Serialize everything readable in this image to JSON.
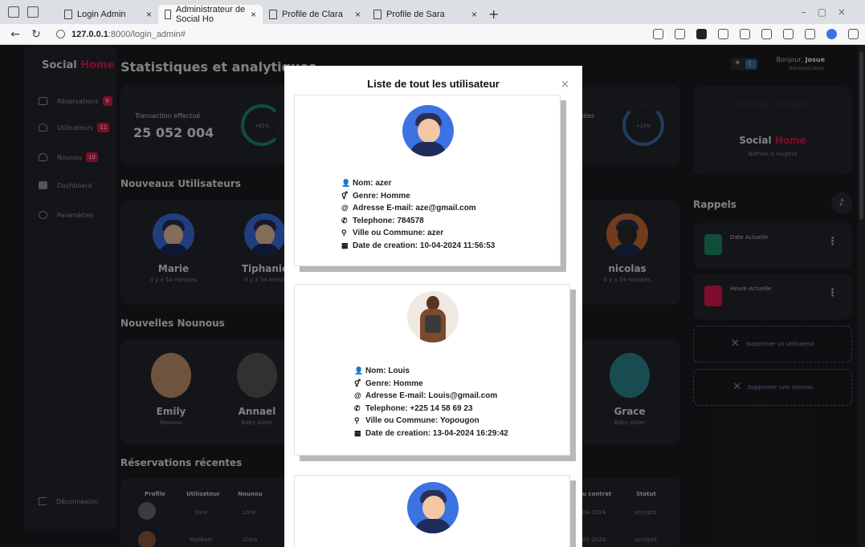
{
  "browser": {
    "tabs": [
      {
        "title": "Login Admin"
      },
      {
        "title": "Administrateur de Social Ho"
      },
      {
        "title": "Profile de Clara"
      },
      {
        "title": "Profile de Sara"
      }
    ],
    "url_host": "127.0.0.1",
    "url_path": ":8000/login_admin#"
  },
  "sidebar": {
    "brand_a": "Social ",
    "brand_b": "Home",
    "items": [
      {
        "label": "Réservations",
        "badge": "8"
      },
      {
        "label": "Utilisateurs",
        "badge": "11"
      },
      {
        "label": "Nounou",
        "badge": "10"
      },
      {
        "label": "Dashboard"
      },
      {
        "label": "Paramètres"
      }
    ],
    "logout": "Déconnexion"
  },
  "header": {
    "title": "Statistiques et analytiques",
    "greeting_prefix": "Bonjour, ",
    "user": "Josue",
    "role": "Administrateur"
  },
  "stats": {
    "transaction_label": "Transaction effectué",
    "transaction_value": "25 052 004",
    "transaction_pct": "+81%",
    "second_label": "uées",
    "second_pct": "+21%"
  },
  "sections": {
    "new_users": "Nouveaux Utilisateurs",
    "new_nannies": "Nouvelles Nounous",
    "recent_bookings": "Réservations récentes"
  },
  "new_users": [
    {
      "name": "Marie",
      "time": "Il y a 54 minutes"
    },
    {
      "name": "Tiphanie",
      "time": "Il y a 54 minut"
    },
    {
      "name": "nicolas",
      "time": "Il y a 54 minutes"
    }
  ],
  "new_nannies": [
    {
      "name": "Emily",
      "role": "Nounou"
    },
    {
      "name": "Annael",
      "role": "Baby sister"
    },
    {
      "name": "Grace",
      "role": "Baby sister"
    }
  ],
  "table": {
    "headers": [
      "Profile",
      "Utilisateur",
      "Nounou",
      "u contrat",
      "Statut"
    ],
    "rows": [
      {
        "user": "Sara",
        "nanny": "Lorie",
        "date": "04-2024",
        "status": "accepté"
      },
      {
        "user": "Malikael",
        "nanny": "Clara",
        "date": "05-2024",
        "status": "accepté"
      }
    ]
  },
  "brand_card": {
    "name_a": "Social ",
    "name_b": "Home",
    "sub": "Nathan & Hugess",
    "logo_text": "SOCIAL HOME"
  },
  "reminders": {
    "title": "Rappels",
    "items": [
      {
        "label": "Date Actuelle"
      },
      {
        "label": "Heure Actuelle"
      }
    ],
    "delete_user": "Supprimer un utilisateur",
    "delete_nanny": "Supprimer une nounou"
  },
  "modal": {
    "title": "Liste de tout les utilisateur",
    "close": "×",
    "users": [
      {
        "nom": "Nom: azer",
        "genre": "Genre: Homme",
        "email": "Adresse E-mail: aze@gmail.com",
        "tel": "Telephone: 784578",
        "ville": "Ville ou Commune: azer",
        "date": "Date de creation: 10-04-2024 11:56:53"
      },
      {
        "nom": "Nom: Louis",
        "genre": "Genre: Homme",
        "email": "Adresse E-mail: Louis@gmail.com",
        "tel": "Telephone: +225 14 58 69 23",
        "ville": "Ville ou Commune: Yopougon",
        "date": "Date de creation: 13-04-2024 16:29:42"
      }
    ]
  },
  "colors": {
    "accent": "#e8174f",
    "panel": "#26272c",
    "background": "#1c1d21",
    "blue": "#3b72e4"
  }
}
